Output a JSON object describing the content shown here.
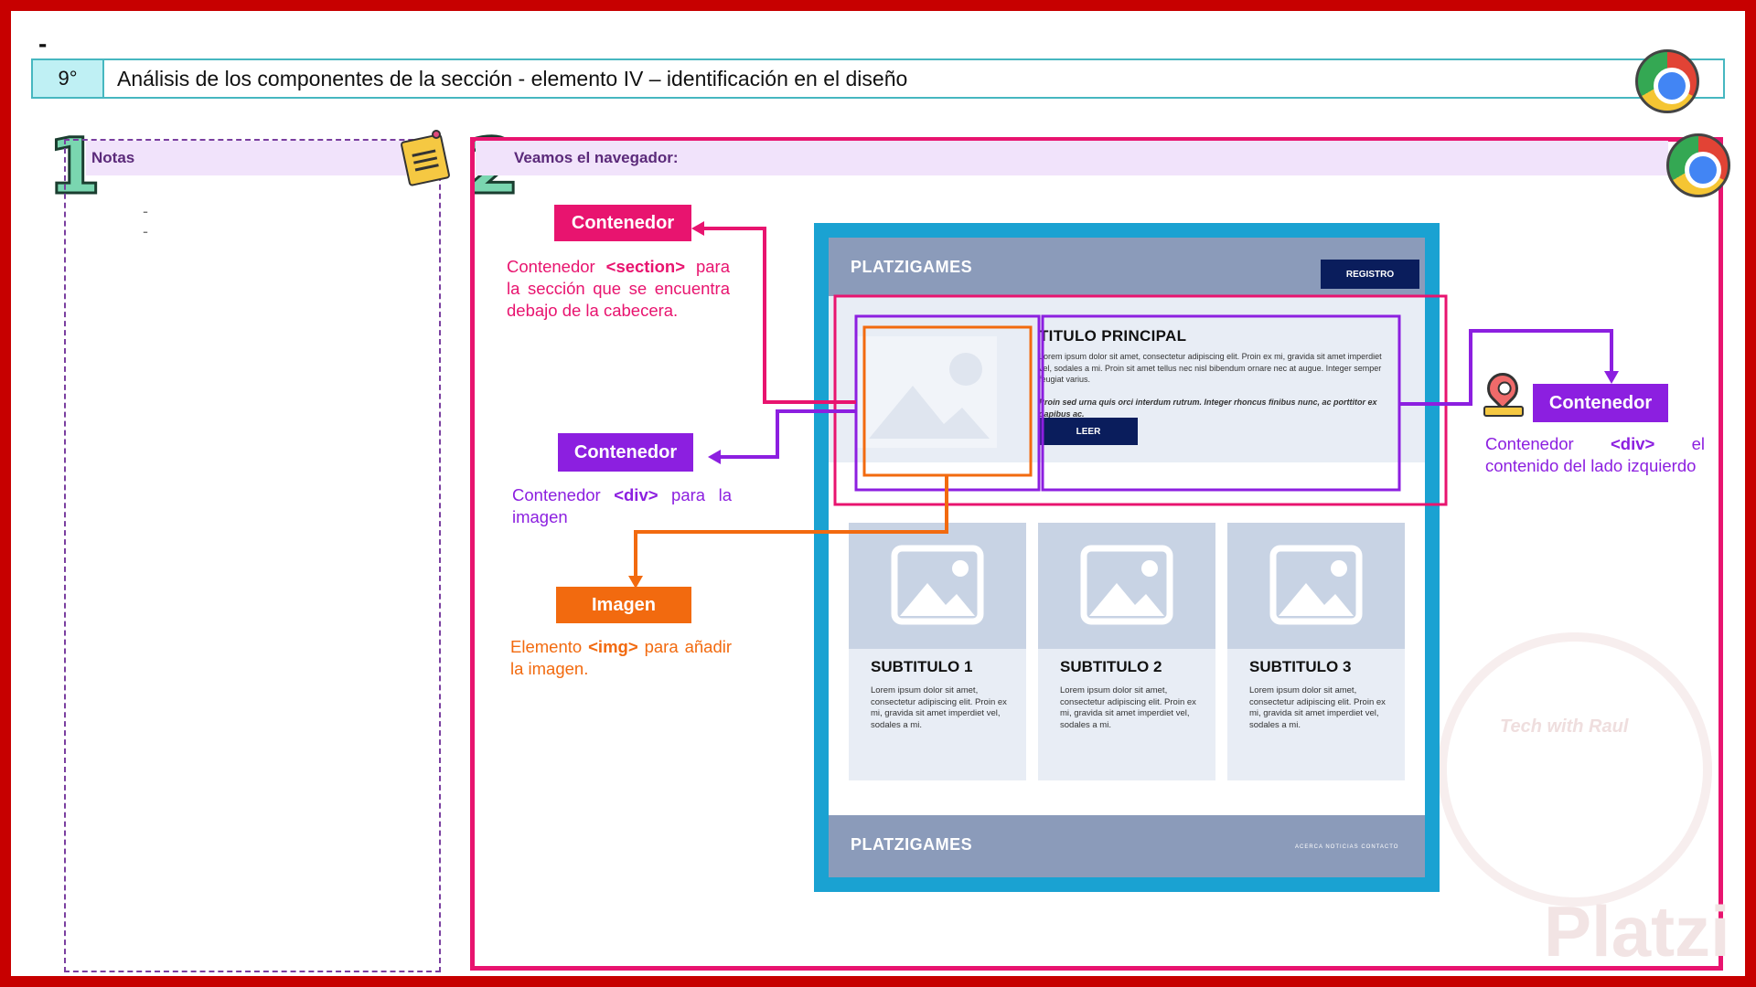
{
  "slide": {
    "top_dash": "-",
    "number": "9°",
    "title": "Análisis de los componentes de la sección  - elemento IV – identificación en el diseño"
  },
  "notes": {
    "step": "1",
    "heading": "Notas",
    "items": [
      "-",
      "-"
    ]
  },
  "browser": {
    "step": "2",
    "heading": "Veamos el navegador:"
  },
  "annotations": {
    "section": {
      "label": "Contenedor",
      "desc_pre": "Contenedor ",
      "tag": "<section>",
      "desc_post": " para la sección que se encuentra debajo de la cabecera.",
      "color": "#e8146f"
    },
    "div_image": {
      "label": "Contenedor",
      "desc_pre": "Contenedor ",
      "tag": "<div>",
      "desc_post": " para la imagen",
      "color": "#8c1fe0"
    },
    "img": {
      "label": "Imagen",
      "desc_pre": "Elemento ",
      "tag": "<img>",
      "desc_post": " para añadir la imagen.",
      "color": "#f26a0f"
    },
    "div_content": {
      "label": "Contenedor",
      "desc_pre": "Contenedor ",
      "tag": "<div>",
      "desc_post": " el contenido del lado izquierdo",
      "color": "#8c1fe0"
    }
  },
  "mockup": {
    "logo": "PLATZIGAMES",
    "register_button": "REGISTRO",
    "main_title": "TITULO PRINCIPAL",
    "main_text": "Lorem ipsum dolor sit amet, consectetur adipiscing elit. Proin ex mi, gravida sit amet imperdiet vel, sodales a mi. Proin sit amet tellus nec nisl bibendum ornare nec at augue. Integer semper feugiat varius.",
    "main_text_italic": "Proin sed urna quis orci interdum rutrum. Integer rhoncus finibus nunc, ac porttitor ex dapibus ac.",
    "read_button": "LEER",
    "cards": [
      {
        "title": "SUBTITULO 1",
        "text": "Lorem ipsum dolor sit amet, consectetur adipiscing elit. Proin ex mi, gravida sit amet imperdiet vel, sodales a mi."
      },
      {
        "title": "SUBTITULO 2",
        "text": "Lorem ipsum dolor sit amet, consectetur adipiscing elit. Proin ex mi, gravida sit amet imperdiet vel, sodales a mi."
      },
      {
        "title": "SUBTITULO 3",
        "text": "Lorem ipsum dolor sit amet, consectetur adipiscing elit. Proin ex mi, gravida sit amet imperdiet vel, sodales a mi."
      }
    ],
    "footer_logo": "PLATZIGAMES",
    "footer_links": "ACERCA  NOTICIAS  CONTACTO"
  },
  "watermark": {
    "brand": "Platzi",
    "badge": "Tech with Raul"
  },
  "icons": {
    "chrome": "chrome-icon",
    "notes": "sticky-note-icon",
    "location": "location-pin-icon"
  }
}
